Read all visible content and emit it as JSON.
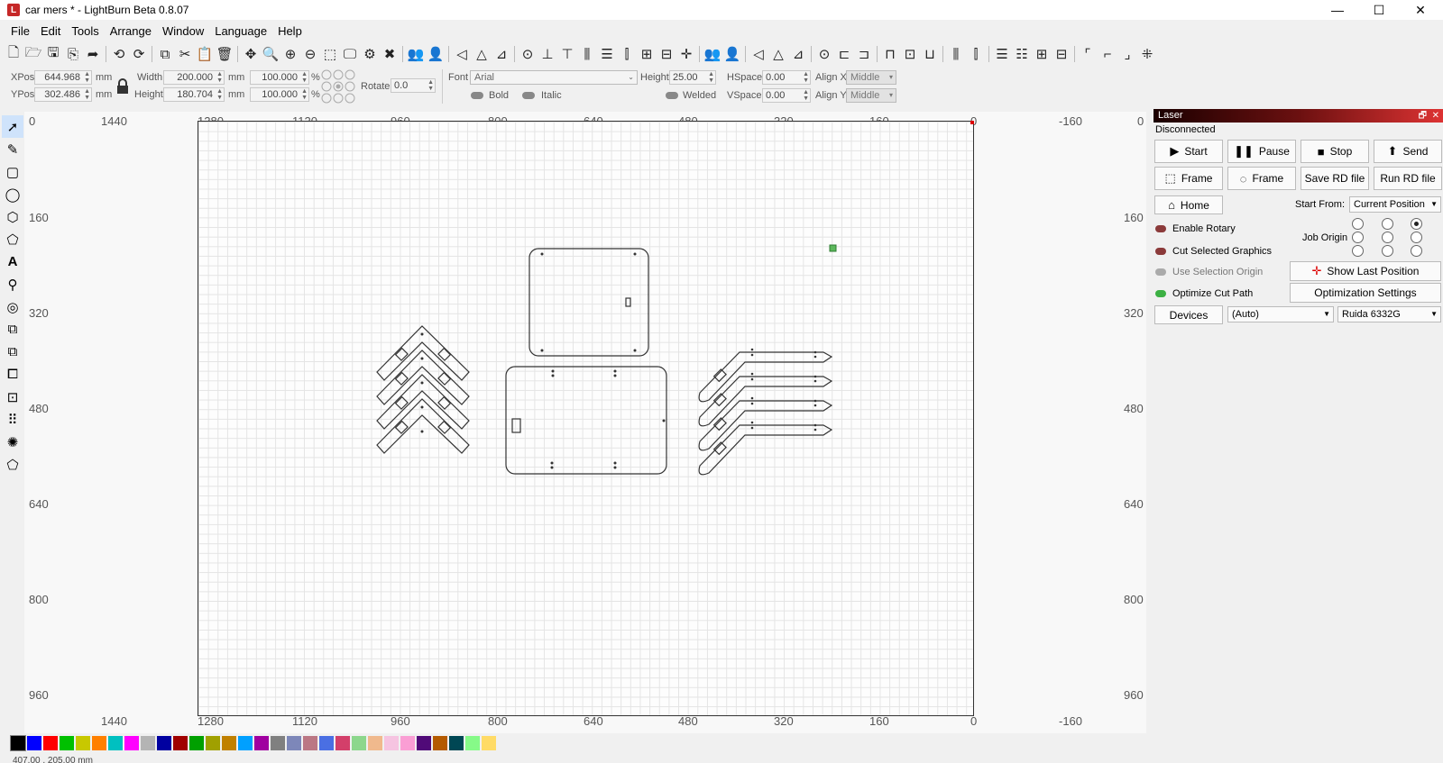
{
  "window": {
    "title": "car mers * - LightBurn Beta 0.8.07",
    "icon_letter": "L",
    "minimize": "—",
    "maximize": "☐",
    "close": "✕"
  },
  "menu": [
    {
      "label": "File"
    },
    {
      "label": "Edit"
    },
    {
      "label": "Tools"
    },
    {
      "label": "Arrange"
    },
    {
      "label": "Window"
    },
    {
      "label": "Language"
    },
    {
      "label": "Help"
    }
  ],
  "props": {
    "xpos_label": "XPos",
    "xpos": "644.968",
    "ypos_label": "YPos",
    "ypos": "302.486",
    "unit": "mm",
    "width_label": "Width",
    "width": "200.000",
    "height_label": "Height",
    "height": "180.704",
    "scale_x": "100.000",
    "scale_y": "100.000",
    "pct": "%",
    "rotate_label": "Rotate",
    "rotate": "0.0",
    "font_label": "Font",
    "font": "Arial",
    "font_height_label": "Height",
    "font_height": "25.00",
    "bold": "Bold",
    "italic": "Italic",
    "welded": "Welded",
    "hspace_label": "HSpace",
    "hspace": "0.00",
    "vspace_label": "VSpace",
    "vspace": "0.00",
    "alignx_label": "Align X",
    "alignx": "Middle",
    "aligny_label": "Align Y",
    "aligny": "Middle"
  },
  "rulers": {
    "top": [
      "1440",
      "1280",
      "1120",
      "960",
      "800",
      "640",
      "480",
      "320",
      "160",
      "0",
      "-160"
    ],
    "bottom": [
      "1440",
      "1280",
      "1120",
      "960",
      "800",
      "640",
      "480",
      "320",
      "160",
      "0",
      "-160"
    ],
    "left": [
      "0",
      "160",
      "320",
      "480",
      "640",
      "800",
      "960"
    ],
    "right": [
      "0",
      "160",
      "320",
      "480",
      "640",
      "800",
      "960"
    ]
  },
  "laser": {
    "title": "Laser",
    "status": "Disconnected",
    "start": "Start",
    "pause": "Pause",
    "stop": "Stop",
    "send": "Send",
    "frame1": "Frame",
    "frame2": "Frame",
    "save_rd": "Save RD file",
    "run_rd": "Run RD file",
    "home": "Home",
    "start_from_label": "Start From:",
    "start_from": "Current Position",
    "enable_rotary": "Enable Rotary",
    "cut_selected": "Cut Selected Graphics",
    "use_selection_origin": "Use Selection Origin",
    "optimize_cut": "Optimize Cut Path",
    "job_origin_label": "Job Origin",
    "show_last": "Show Last Position",
    "opt_settings": "Optimization Settings",
    "devices": "Devices",
    "device_port": "(Auto)",
    "device_model": "Ruida 6332G",
    "panel_float": "🗗",
    "panel_close": "✕"
  },
  "colors": {
    "accent_red": "#c62828",
    "workspace_bg": "#fdfdfd",
    "selection_green": "#5cb85c"
  },
  "palette": [
    "#000000",
    "#0000ff",
    "#ff0000",
    "#00c000",
    "#c8c800",
    "#ff8000",
    "#00c0c0",
    "#ff00ff",
    "#b4b4b4",
    "#0000a0",
    "#a00000",
    "#00a000",
    "#a0a000",
    "#c08000",
    "#00a0ff",
    "#a000a0",
    "#808080",
    "#7d87b9",
    "#bb7784",
    "#4a6fe3",
    "#d33f6a",
    "#8cd78c",
    "#f0b98d",
    "#f6c4e1",
    "#fa9ed4",
    "#500a78",
    "#b45a00",
    "#004754",
    "#86fa88",
    "#ffdb66"
  ],
  "status": {
    "coords": "407.00 , 205.00 mm"
  }
}
